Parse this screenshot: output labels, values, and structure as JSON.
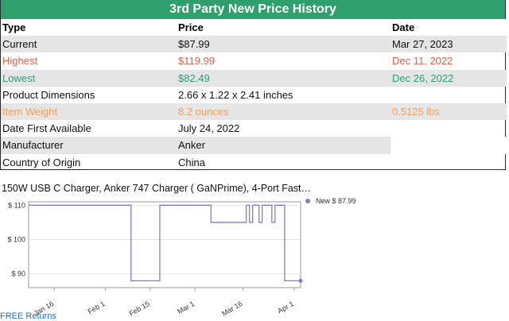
{
  "title": "3rd Party New Price History",
  "table": {
    "headers": [
      "Type",
      "Price",
      "Date"
    ],
    "rows": [
      {
        "type": "Current",
        "price": "$87.99",
        "date": "Mar 27, 2023",
        "tone": "dark"
      },
      {
        "type": "Highest",
        "price": "$119.99",
        "date": "Dec 11, 2022",
        "tone": "red"
      },
      {
        "type": "Lowest",
        "price": "$82.49",
        "date": "Dec 26, 2022",
        "tone": "green"
      },
      {
        "type": "Product Dimensions",
        "price": "2.66 x 1.22 x 2.41 inches",
        "date": "",
        "tone": "dark"
      },
      {
        "type": "Item Weight",
        "price": "8.2 ounces",
        "date": "0.5125 lbs",
        "tone": "orange"
      },
      {
        "type": "Date First Available",
        "price": "July 24, 2022",
        "date": "",
        "tone": "dark"
      },
      {
        "type": "Manufacturer",
        "price": "Anker",
        "date": "",
        "tone": "dark"
      },
      {
        "type": "Country of Origin",
        "price": "China",
        "date": "",
        "tone": "dark"
      }
    ]
  },
  "product_title": "150W USB C Charger, Anker 747 Charger ( GaNPrime), 4-Port Fast…",
  "footer_link": "FREE Returns",
  "colors": {
    "header_green": "#2e9f6d",
    "highest_red": "#e55e4a",
    "lowest_green": "#2e9f6d",
    "weight_orange": "#f1a05a",
    "series_line": "#7b7fd4",
    "row_alt": "#e5e5e5"
  },
  "chart_data": {
    "type": "line",
    "series": [
      {
        "name": "New $ 87.99",
        "color": "#7b7fd4",
        "points": [
          [
            "2023-01-08",
            110
          ],
          [
            "2023-02-09",
            110
          ],
          [
            "2023-02-09",
            88
          ],
          [
            "2023-02-18",
            88
          ],
          [
            "2023-02-18",
            110
          ],
          [
            "2023-03-06",
            110
          ],
          [
            "2023-03-06",
            105
          ],
          [
            "2023-03-17",
            105
          ],
          [
            "2023-03-17",
            110
          ],
          [
            "2023-03-18",
            110
          ],
          [
            "2023-03-18",
            105
          ],
          [
            "2023-03-19",
            105
          ],
          [
            "2023-03-19",
            110
          ],
          [
            "2023-03-21",
            110
          ],
          [
            "2023-03-21",
            105
          ],
          [
            "2023-03-22",
            105
          ],
          [
            "2023-03-22",
            110
          ],
          [
            "2023-03-25",
            110
          ],
          [
            "2023-03-25",
            105
          ],
          [
            "2023-03-26",
            105
          ],
          [
            "2023-03-26",
            110
          ],
          [
            "2023-03-29",
            110
          ],
          [
            "2023-03-29",
            88
          ],
          [
            "2023-04-03",
            88
          ]
        ]
      }
    ],
    "y_ticks": [
      110,
      100,
      90
    ],
    "y_tick_labels": [
      "$ 110",
      "$ 100",
      "$ 90"
    ],
    "ylim": [
      86,
      111
    ],
    "x_ticks": [
      {
        "date": "2023-01-16",
        "label": "Jan 16"
      },
      {
        "date": "2023-02-01",
        "label": "Feb 1"
      },
      {
        "date": "2023-02-15",
        "label": "Feb 15"
      },
      {
        "date": "2023-03-01",
        "label": "Mar 1"
      },
      {
        "date": "2023-03-16",
        "label": "Mar 16"
      },
      {
        "date": "2023-04-01",
        "label": "Apr 1"
      }
    ],
    "xlim": [
      "2023-01-08",
      "2023-04-03"
    ],
    "grid": "horizontal",
    "legend_position": "top-right",
    "endpoint_marker": true
  }
}
